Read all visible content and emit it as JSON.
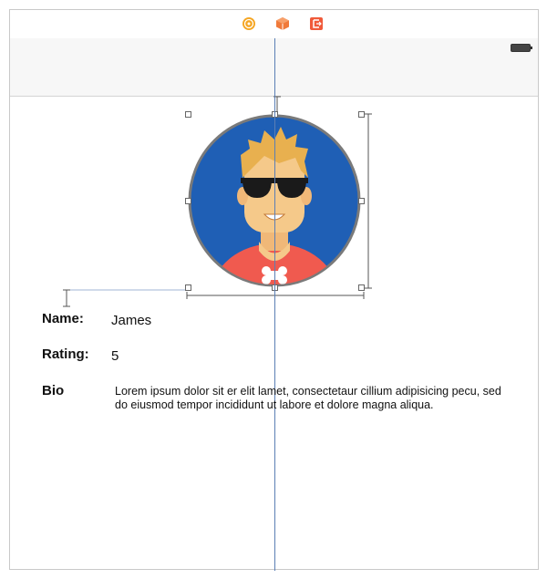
{
  "canvas": {
    "dock_icons": [
      "view-controller-icon",
      "first-responder-icon",
      "exit-icon"
    ]
  },
  "profile": {
    "name_label": "Name:",
    "name_value": "James",
    "rating_label": "Rating:",
    "rating_value": "5",
    "bio_label": "Bio",
    "bio_value": "Lorem ipsum dolor sit er elit lamet, consectetaur cillium adipisicing pecu, sed do eiusmod tempor incididunt ut labore et dolore magna aliqua."
  },
  "colors": {
    "avatar_background": "#1f5fb5",
    "avatar_border": "#7a7a7a",
    "skin": "#f5c98a",
    "hair": "#e8b04f",
    "shirt": "#f05a4f",
    "guide": "#5b7fb5"
  }
}
